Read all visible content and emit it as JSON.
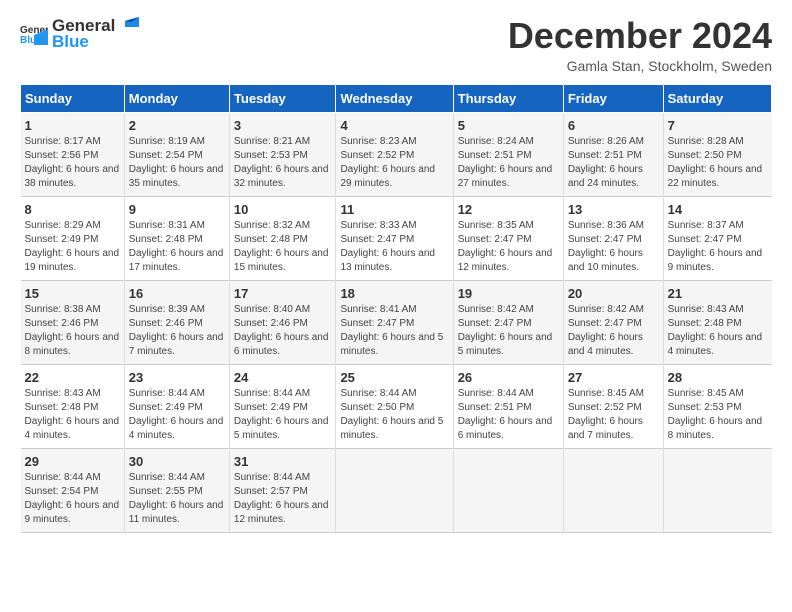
{
  "header": {
    "logo_general": "General",
    "logo_blue": "Blue",
    "title": "December 2024",
    "subtitle": "Gamla Stan, Stockholm, Sweden"
  },
  "weekdays": [
    "Sunday",
    "Monday",
    "Tuesday",
    "Wednesday",
    "Thursday",
    "Friday",
    "Saturday"
  ],
  "weeks": [
    [
      {
        "day": "1",
        "sunrise": "8:17 AM",
        "sunset": "2:56 PM",
        "daylight": "6 hours and 38 minutes."
      },
      {
        "day": "2",
        "sunrise": "8:19 AM",
        "sunset": "2:54 PM",
        "daylight": "6 hours and 35 minutes."
      },
      {
        "day": "3",
        "sunrise": "8:21 AM",
        "sunset": "2:53 PM",
        "daylight": "6 hours and 32 minutes."
      },
      {
        "day": "4",
        "sunrise": "8:23 AM",
        "sunset": "2:52 PM",
        "daylight": "6 hours and 29 minutes."
      },
      {
        "day": "5",
        "sunrise": "8:24 AM",
        "sunset": "2:51 PM",
        "daylight": "6 hours and 27 minutes."
      },
      {
        "day": "6",
        "sunrise": "8:26 AM",
        "sunset": "2:51 PM",
        "daylight": "6 hours and 24 minutes."
      },
      {
        "day": "7",
        "sunrise": "8:28 AM",
        "sunset": "2:50 PM",
        "daylight": "6 hours and 22 minutes."
      }
    ],
    [
      {
        "day": "8",
        "sunrise": "8:29 AM",
        "sunset": "2:49 PM",
        "daylight": "6 hours and 19 minutes."
      },
      {
        "day": "9",
        "sunrise": "8:31 AM",
        "sunset": "2:48 PM",
        "daylight": "6 hours and 17 minutes."
      },
      {
        "day": "10",
        "sunrise": "8:32 AM",
        "sunset": "2:48 PM",
        "daylight": "6 hours and 15 minutes."
      },
      {
        "day": "11",
        "sunrise": "8:33 AM",
        "sunset": "2:47 PM",
        "daylight": "6 hours and 13 minutes."
      },
      {
        "day": "12",
        "sunrise": "8:35 AM",
        "sunset": "2:47 PM",
        "daylight": "6 hours and 12 minutes."
      },
      {
        "day": "13",
        "sunrise": "8:36 AM",
        "sunset": "2:47 PM",
        "daylight": "6 hours and 10 minutes."
      },
      {
        "day": "14",
        "sunrise": "8:37 AM",
        "sunset": "2:47 PM",
        "daylight": "6 hours and 9 minutes."
      }
    ],
    [
      {
        "day": "15",
        "sunrise": "8:38 AM",
        "sunset": "2:46 PM",
        "daylight": "6 hours and 8 minutes."
      },
      {
        "day": "16",
        "sunrise": "8:39 AM",
        "sunset": "2:46 PM",
        "daylight": "6 hours and 7 minutes."
      },
      {
        "day": "17",
        "sunrise": "8:40 AM",
        "sunset": "2:46 PM",
        "daylight": "6 hours and 6 minutes."
      },
      {
        "day": "18",
        "sunrise": "8:41 AM",
        "sunset": "2:47 PM",
        "daylight": "6 hours and 5 minutes."
      },
      {
        "day": "19",
        "sunrise": "8:42 AM",
        "sunset": "2:47 PM",
        "daylight": "6 hours and 5 minutes."
      },
      {
        "day": "20",
        "sunrise": "8:42 AM",
        "sunset": "2:47 PM",
        "daylight": "6 hours and 4 minutes."
      },
      {
        "day": "21",
        "sunrise": "8:43 AM",
        "sunset": "2:48 PM",
        "daylight": "6 hours and 4 minutes."
      }
    ],
    [
      {
        "day": "22",
        "sunrise": "8:43 AM",
        "sunset": "2:48 PM",
        "daylight": "6 hours and 4 minutes."
      },
      {
        "day": "23",
        "sunrise": "8:44 AM",
        "sunset": "2:49 PM",
        "daylight": "6 hours and 4 minutes."
      },
      {
        "day": "24",
        "sunrise": "8:44 AM",
        "sunset": "2:49 PM",
        "daylight": "6 hours and 5 minutes."
      },
      {
        "day": "25",
        "sunrise": "8:44 AM",
        "sunset": "2:50 PM",
        "daylight": "6 hours and 5 minutes."
      },
      {
        "day": "26",
        "sunrise": "8:44 AM",
        "sunset": "2:51 PM",
        "daylight": "6 hours and 6 minutes."
      },
      {
        "day": "27",
        "sunrise": "8:45 AM",
        "sunset": "2:52 PM",
        "daylight": "6 hours and 7 minutes."
      },
      {
        "day": "28",
        "sunrise": "8:45 AM",
        "sunset": "2:53 PM",
        "daylight": "6 hours and 8 minutes."
      }
    ],
    [
      {
        "day": "29",
        "sunrise": "8:44 AM",
        "sunset": "2:54 PM",
        "daylight": "6 hours and 9 minutes."
      },
      {
        "day": "30",
        "sunrise": "8:44 AM",
        "sunset": "2:55 PM",
        "daylight": "6 hours and 11 minutes."
      },
      {
        "day": "31",
        "sunrise": "8:44 AM",
        "sunset": "2:57 PM",
        "daylight": "6 hours and 12 minutes."
      },
      null,
      null,
      null,
      null
    ]
  ],
  "labels": {
    "sunrise": "Sunrise:",
    "sunset": "Sunset:",
    "daylight": "Daylight:"
  }
}
